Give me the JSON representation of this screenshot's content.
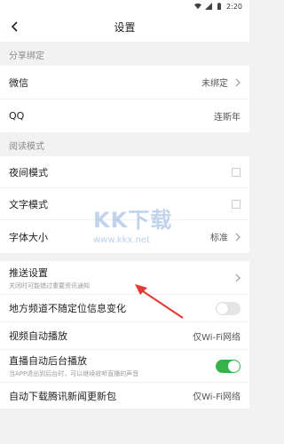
{
  "statusbar": {
    "time": "2:20"
  },
  "header": {
    "title": "设置"
  },
  "sections": {
    "share": {
      "title": "分享绑定",
      "wechat": {
        "label": "微信",
        "value": "未绑定"
      },
      "qq": {
        "label": "QQ",
        "value": "连斯年"
      }
    },
    "reading": {
      "title": "阅读模式",
      "night": {
        "label": "夜间模式"
      },
      "text": {
        "label": "文字模式"
      },
      "font": {
        "label": "字体大小",
        "value": "标准"
      }
    },
    "push": {
      "label": "推送设置",
      "sub": "关闭时可能错过重要资讯通知"
    },
    "local": {
      "label": "地方频道不随定位信息变化"
    },
    "video": {
      "label": "视频自动播放",
      "value": "仅Wi-Fi网络"
    },
    "live": {
      "label": "直播自动后台播放",
      "sub": "当APP退出到后台时，可以继续收听直播的声音"
    },
    "download": {
      "label": "自动下载腾讯新闻更新包",
      "value": "仅Wi-Fi网络"
    }
  },
  "watermark": {
    "text": "KK下载",
    "url": "www.kkx.net"
  },
  "colors": {
    "toggle_on": "#36b24a",
    "arrow": "#e53935",
    "background": "#f2f2f2"
  },
  "icons": [
    "wifi-icon",
    "signal-icon",
    "battery-icon",
    "back-icon",
    "chevron-right-icon"
  ]
}
